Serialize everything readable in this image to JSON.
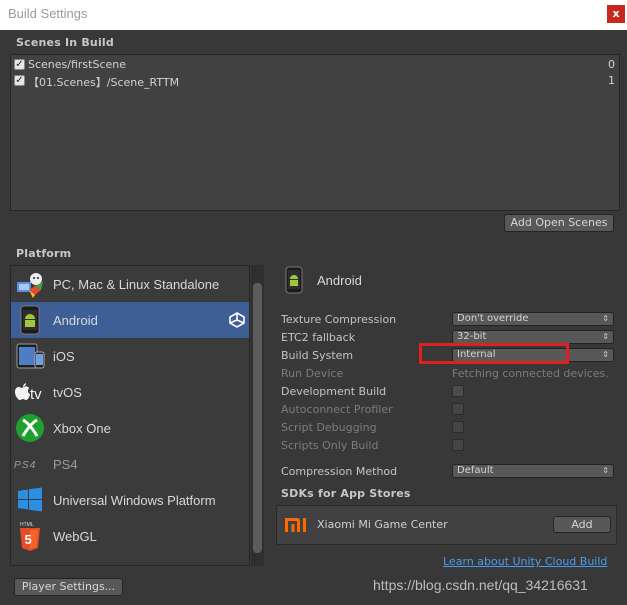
{
  "window": {
    "title": "Build Settings",
    "close_glyph": "x"
  },
  "scenes": {
    "header": "Scenes In Build",
    "items": [
      {
        "name": "Scenes/firstScene",
        "index": "0",
        "checked": true
      },
      {
        "name": "【01.Scenes】/Scene_RTTM",
        "index": "1",
        "checked": true
      }
    ],
    "add_open_scenes_label": "Add Open Scenes"
  },
  "platform": {
    "header": "Platform",
    "items": [
      {
        "label": "PC, Mac & Linux Standalone",
        "icon": "pc-standalone-icon",
        "selected": false
      },
      {
        "label": "Android",
        "icon": "android-icon",
        "selected": true
      },
      {
        "label": "iOS",
        "icon": "ios-icon",
        "selected": false
      },
      {
        "label": "tvOS",
        "icon": "apple-tv-icon",
        "selected": false
      },
      {
        "label": "Xbox One",
        "icon": "xbox-icon",
        "selected": false
      },
      {
        "label": "PS4",
        "icon": "ps4-icon",
        "selected": false
      },
      {
        "label": "Universal Windows Platform",
        "icon": "windows-icon",
        "selected": false
      },
      {
        "label": "WebGL",
        "icon": "html5-icon",
        "selected": false
      }
    ]
  },
  "settings": {
    "platform_title": "Android",
    "texture_compression": {
      "label": "Texture Compression",
      "value": "Don't override"
    },
    "etc2_fallback": {
      "label": "ETC2 fallback",
      "value": "32-bit"
    },
    "build_system": {
      "label": "Build System",
      "value": "Internal"
    },
    "run_device": {
      "label": "Run Device",
      "value": "Fetching connected devices."
    },
    "development_build": {
      "label": "Development Build",
      "checked": false
    },
    "autoconnect_profiler": {
      "label": "Autoconnect Profiler",
      "checked": false
    },
    "script_debugging": {
      "label": "Script Debugging",
      "checked": false
    },
    "scripts_only_build": {
      "label": "Scripts Only Build",
      "checked": false
    },
    "compression_method": {
      "label": "Compression Method",
      "value": "Default"
    },
    "sdks_header": "SDKs for App Stores",
    "sdk_item": {
      "name": "Xiaomi Mi Game Center",
      "add_label": "Add"
    },
    "cloud_build_link": "Learn about Unity Cloud Build"
  },
  "footer": {
    "player_settings_label": "Player Settings...",
    "watermark": "https://blog.csdn.net/qq_34216631"
  },
  "colors": {
    "selection": "#3e5f96",
    "highlight_box": "#e0201e",
    "link": "#4a9df0"
  }
}
